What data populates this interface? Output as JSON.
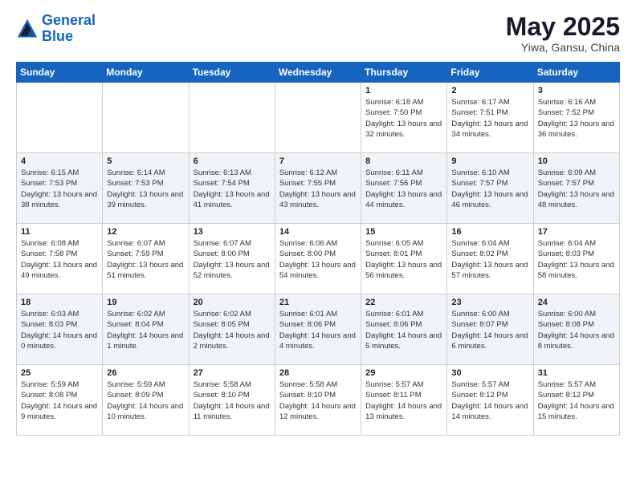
{
  "header": {
    "logo_line1": "General",
    "logo_line2": "Blue",
    "title": "May 2025",
    "subtitle": "Yiwa, Gansu, China"
  },
  "calendar": {
    "days_of_week": [
      "Sunday",
      "Monday",
      "Tuesday",
      "Wednesday",
      "Thursday",
      "Friday",
      "Saturday"
    ],
    "weeks": [
      [
        {
          "num": "",
          "info": ""
        },
        {
          "num": "",
          "info": ""
        },
        {
          "num": "",
          "info": ""
        },
        {
          "num": "",
          "info": ""
        },
        {
          "num": "1",
          "info": "Sunrise: 6:18 AM\nSunset: 7:50 PM\nDaylight: 13 hours\nand 32 minutes."
        },
        {
          "num": "2",
          "info": "Sunrise: 6:17 AM\nSunset: 7:51 PM\nDaylight: 13 hours\nand 34 minutes."
        },
        {
          "num": "3",
          "info": "Sunrise: 6:16 AM\nSunset: 7:52 PM\nDaylight: 13 hours\nand 36 minutes."
        }
      ],
      [
        {
          "num": "4",
          "info": "Sunrise: 6:15 AM\nSunset: 7:53 PM\nDaylight: 13 hours\nand 38 minutes."
        },
        {
          "num": "5",
          "info": "Sunrise: 6:14 AM\nSunset: 7:53 PM\nDaylight: 13 hours\nand 39 minutes."
        },
        {
          "num": "6",
          "info": "Sunrise: 6:13 AM\nSunset: 7:54 PM\nDaylight: 13 hours\nand 41 minutes."
        },
        {
          "num": "7",
          "info": "Sunrise: 6:12 AM\nSunset: 7:55 PM\nDaylight: 13 hours\nand 43 minutes."
        },
        {
          "num": "8",
          "info": "Sunrise: 6:11 AM\nSunset: 7:56 PM\nDaylight: 13 hours\nand 44 minutes."
        },
        {
          "num": "9",
          "info": "Sunrise: 6:10 AM\nSunset: 7:57 PM\nDaylight: 13 hours\nand 46 minutes."
        },
        {
          "num": "10",
          "info": "Sunrise: 6:09 AM\nSunset: 7:57 PM\nDaylight: 13 hours\nand 48 minutes."
        }
      ],
      [
        {
          "num": "11",
          "info": "Sunrise: 6:08 AM\nSunset: 7:58 PM\nDaylight: 13 hours\nand 49 minutes."
        },
        {
          "num": "12",
          "info": "Sunrise: 6:07 AM\nSunset: 7:59 PM\nDaylight: 13 hours\nand 51 minutes."
        },
        {
          "num": "13",
          "info": "Sunrise: 6:07 AM\nSunset: 8:00 PM\nDaylight: 13 hours\nand 52 minutes."
        },
        {
          "num": "14",
          "info": "Sunrise: 6:06 AM\nSunset: 8:00 PM\nDaylight: 13 hours\nand 54 minutes."
        },
        {
          "num": "15",
          "info": "Sunrise: 6:05 AM\nSunset: 8:01 PM\nDaylight: 13 hours\nand 56 minutes."
        },
        {
          "num": "16",
          "info": "Sunrise: 6:04 AM\nSunset: 8:02 PM\nDaylight: 13 hours\nand 57 minutes."
        },
        {
          "num": "17",
          "info": "Sunrise: 6:04 AM\nSunset: 8:03 PM\nDaylight: 13 hours\nand 58 minutes."
        }
      ],
      [
        {
          "num": "18",
          "info": "Sunrise: 6:03 AM\nSunset: 8:03 PM\nDaylight: 14 hours\nand 0 minutes."
        },
        {
          "num": "19",
          "info": "Sunrise: 6:02 AM\nSunset: 8:04 PM\nDaylight: 14 hours\nand 1 minute."
        },
        {
          "num": "20",
          "info": "Sunrise: 6:02 AM\nSunset: 8:05 PM\nDaylight: 14 hours\nand 2 minutes."
        },
        {
          "num": "21",
          "info": "Sunrise: 6:01 AM\nSunset: 8:06 PM\nDaylight: 14 hours\nand 4 minutes."
        },
        {
          "num": "22",
          "info": "Sunrise: 6:01 AM\nSunset: 8:06 PM\nDaylight: 14 hours\nand 5 minutes."
        },
        {
          "num": "23",
          "info": "Sunrise: 6:00 AM\nSunset: 8:07 PM\nDaylight: 14 hours\nand 6 minutes."
        },
        {
          "num": "24",
          "info": "Sunrise: 6:00 AM\nSunset: 8:08 PM\nDaylight: 14 hours\nand 8 minutes."
        }
      ],
      [
        {
          "num": "25",
          "info": "Sunrise: 5:59 AM\nSunset: 8:08 PM\nDaylight: 14 hours\nand 9 minutes."
        },
        {
          "num": "26",
          "info": "Sunrise: 5:59 AM\nSunset: 8:09 PM\nDaylight: 14 hours\nand 10 minutes."
        },
        {
          "num": "27",
          "info": "Sunrise: 5:58 AM\nSunset: 8:10 PM\nDaylight: 14 hours\nand 11 minutes."
        },
        {
          "num": "28",
          "info": "Sunrise: 5:58 AM\nSunset: 8:10 PM\nDaylight: 14 hours\nand 12 minutes."
        },
        {
          "num": "29",
          "info": "Sunrise: 5:57 AM\nSunset: 8:11 PM\nDaylight: 14 hours\nand 13 minutes."
        },
        {
          "num": "30",
          "info": "Sunrise: 5:57 AM\nSunset: 8:12 PM\nDaylight: 14 hours\nand 14 minutes."
        },
        {
          "num": "31",
          "info": "Sunrise: 5:57 AM\nSunset: 8:12 PM\nDaylight: 14 hours\nand 15 minutes."
        }
      ]
    ]
  }
}
